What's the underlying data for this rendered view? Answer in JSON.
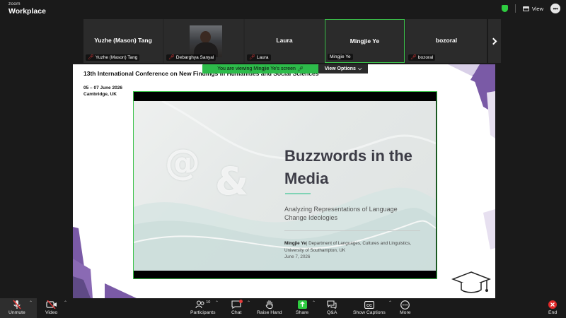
{
  "app": {
    "brand_small": "zoom",
    "brand_big": "Workplace",
    "view_label": "View"
  },
  "gallery": {
    "tiles": [
      {
        "name": "Yuzhe (Mason) Tang",
        "label": "Yuzhe (Mason) Tang",
        "muted": true
      },
      {
        "name": "",
        "label": "Debarghya Sanyal",
        "muted": true,
        "video": true
      },
      {
        "name": "Laura",
        "label": "Laura",
        "muted": true
      },
      {
        "name": "Mingjie Ye",
        "label": "Mingjie Ye",
        "muted": false,
        "active": true
      },
      {
        "name": "bozoral",
        "label": "bozoral",
        "muted": true
      }
    ]
  },
  "banner": {
    "text": "You are viewing  Mingjie Ye's screen",
    "options_label": "View Options"
  },
  "screen": {
    "conference_title": "13th International Conference on New Findings in Humanities and Social Sciences",
    "date_line1": "05 – 07 June 2026",
    "date_line2": "Cambridge, UK",
    "slide": {
      "title_line1": "Buzzwords in the",
      "title_line2": "Media",
      "subtitle_line1": "Analyzing Representations of Language",
      "subtitle_line2": "Change Ideologies",
      "author_name": "Mingjie Ye",
      "author_affil": "| Department of Languages, Cultures and Linguistics, University of Southampton, UK",
      "date": "June 7, 2026"
    }
  },
  "toolbar": {
    "unmute": "Unmute",
    "video": "Video",
    "participants": "Participants",
    "participants_count": "10",
    "chat": "Chat",
    "raise_hand": "Raise Hand",
    "share": "Share",
    "qa": "Q&A",
    "captions": "Show Captions",
    "more": "More",
    "end": "End"
  },
  "colors": {
    "active_border": "#3bc24a",
    "banner": "#2dbb4a",
    "end": "#e02828",
    "share": "#2ecc40",
    "accent_purple": "#7a5aa6"
  }
}
